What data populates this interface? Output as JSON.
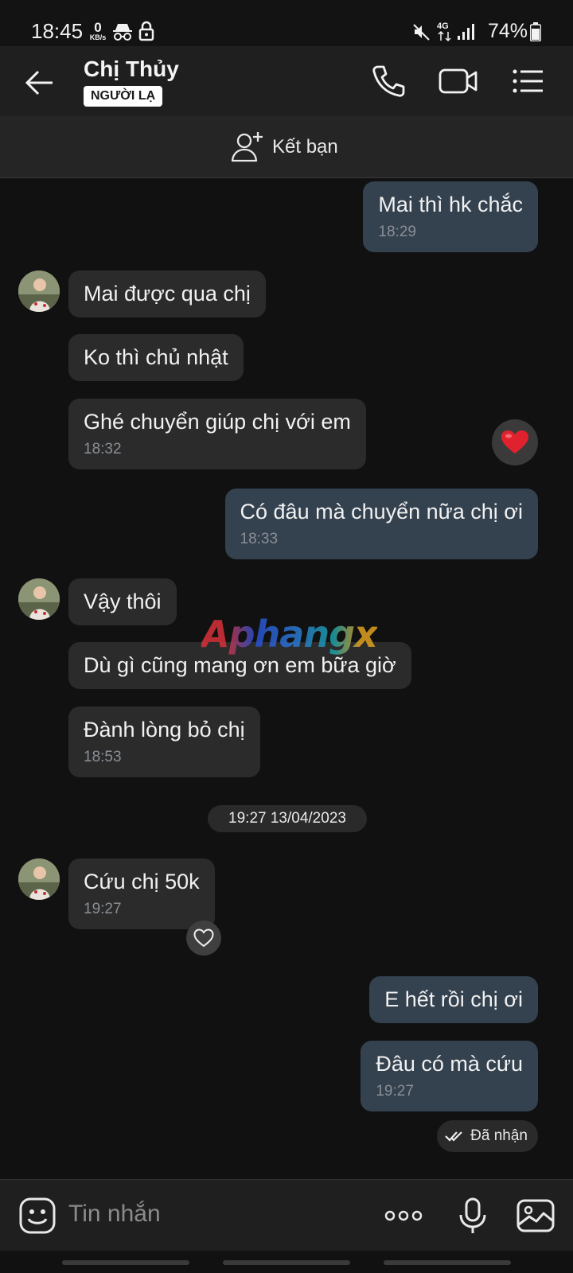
{
  "status_bar": {
    "time": "18:45",
    "net_speed_value": "0",
    "net_speed_unit": "KB/s",
    "network_type": "4G",
    "battery": "74%"
  },
  "header": {
    "contact_name": "Chị Thủy",
    "badge": "NGƯỜI LẠ"
  },
  "friend_bar": {
    "label": "Kết bạn"
  },
  "messages": [
    {
      "side": "out",
      "text": "Mai thì hk chắc",
      "time": "18:29"
    },
    {
      "side": "in",
      "text": "Mai được qua chị"
    },
    {
      "side": "in",
      "text": "Ko thì chủ nhật"
    },
    {
      "side": "in",
      "text": "Ghé chuyển giúp chị với em",
      "time": "18:32",
      "reaction": "heart"
    },
    {
      "side": "out",
      "text": "Có đâu mà chuyển nữa chị ơi",
      "time": "18:33"
    },
    {
      "side": "in",
      "text": "Vậy thôi"
    },
    {
      "side": "in",
      "text": "Dù gì cũng mang ơn em bữa giờ"
    },
    {
      "side": "in",
      "text": "Đành lòng bỏ chị",
      "time": "18:53"
    },
    {
      "side": "in",
      "text": "Cứu chị 50k",
      "time": "19:27"
    },
    {
      "side": "out",
      "text": "E hết rồi chị ơi"
    },
    {
      "side": "out",
      "text": "Đâu có mà cứu",
      "time": "19:27"
    }
  ],
  "date_separator": "19:27 13/04/2023",
  "delivery_status": "Đã nhận",
  "watermark": "Aphangx",
  "input": {
    "placeholder": "Tin nhắn"
  },
  "icons": {
    "back": "arrow-left-icon",
    "call": "phone-icon",
    "video": "video-camera-icon",
    "menu": "list-menu-icon",
    "add_friend": "add-user-icon",
    "sticker": "emoji-icon",
    "more": "more-dots-icon",
    "mic": "microphone-icon",
    "image": "image-icon",
    "reaction": "heart-icon"
  },
  "colors": {
    "incoming_bubble": "#2b2b2b",
    "outgoing_bubble": "#34414f",
    "background": "#111111"
  }
}
